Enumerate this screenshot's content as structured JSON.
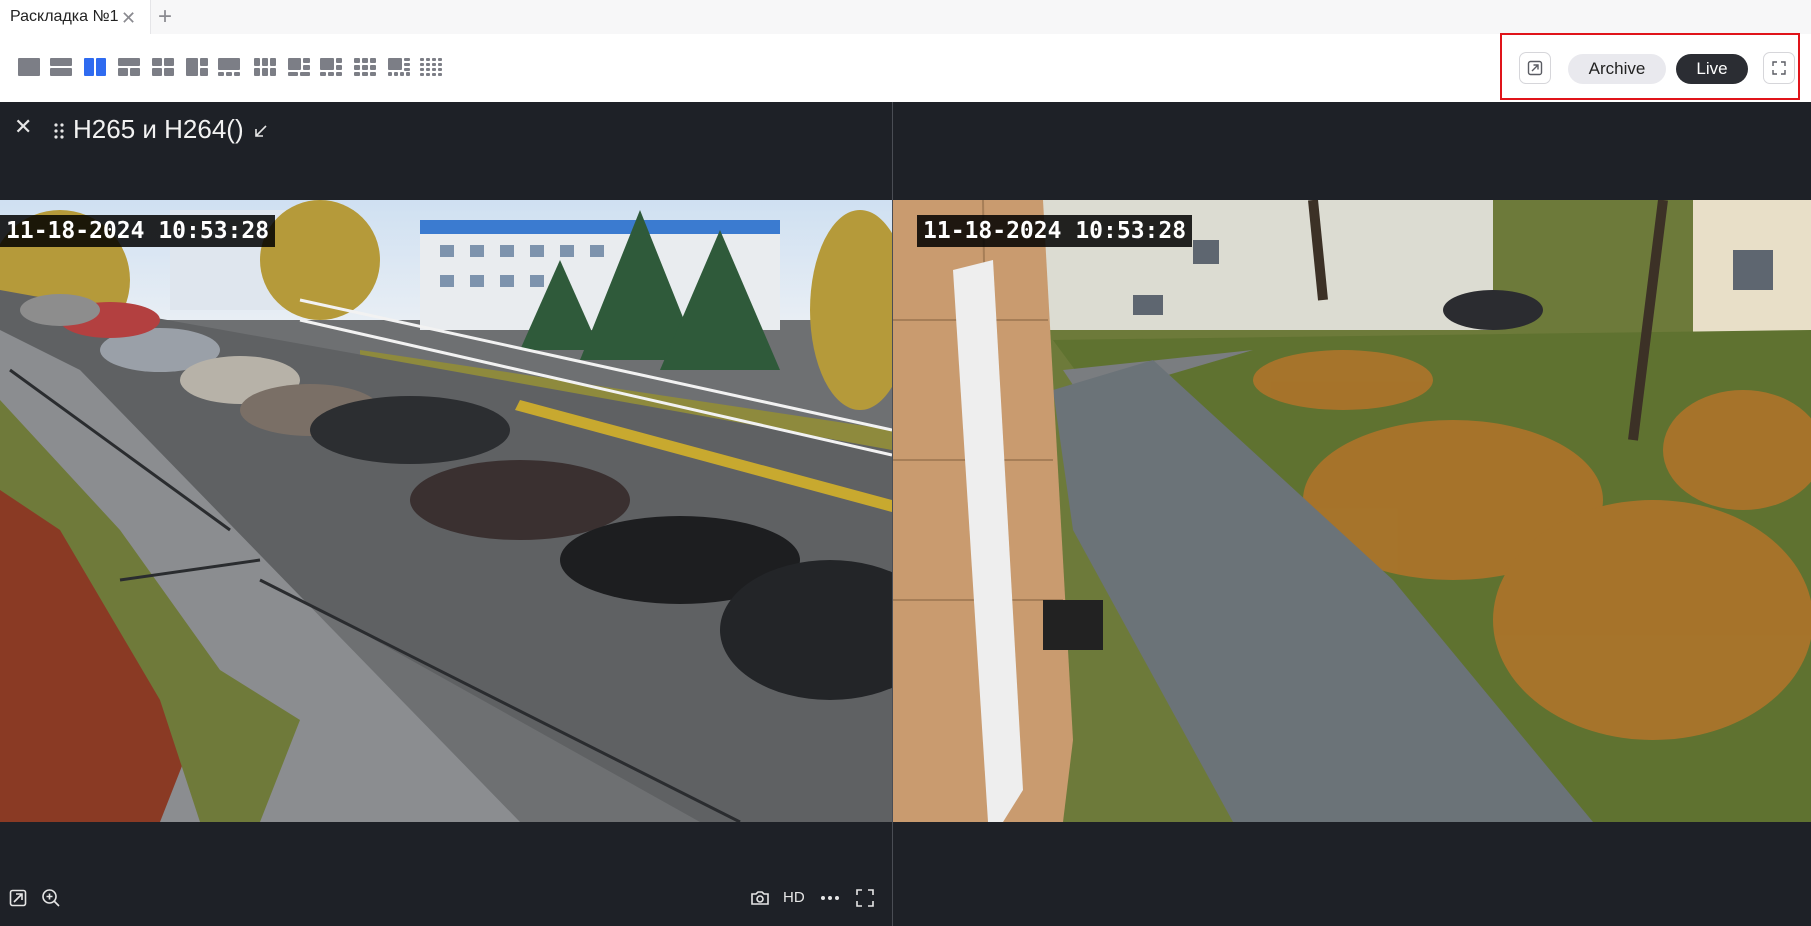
{
  "tabs": [
    {
      "label": "Раскладка №1",
      "close_icon": "close-icon",
      "active": true
    }
  ],
  "add_tab_icon": "plus-icon",
  "layout_buttons": [
    {
      "name": "layout-1x1",
      "active": false
    },
    {
      "name": "layout-2-rows",
      "active": false
    },
    {
      "name": "layout-2-columns",
      "active": true
    },
    {
      "name": "layout-1-top-2-bottom",
      "active": false
    },
    {
      "name": "layout-2x2",
      "active": false
    },
    {
      "name": "layout-1-big-2-side",
      "active": false
    },
    {
      "name": "layout-1-big-3-bottom",
      "active": false
    },
    {
      "name": "layout-3x2",
      "active": false
    },
    {
      "name": "layout-1-big-4",
      "active": false
    },
    {
      "name": "layout-1-big-5",
      "active": false
    },
    {
      "name": "layout-3x3",
      "active": false
    },
    {
      "name": "layout-1-big-7",
      "active": false
    },
    {
      "name": "layout-4x4",
      "active": false
    }
  ],
  "controls": {
    "exit_icon": "open-in-new-window-icon",
    "archive_label": "Archive",
    "live_label": "Live",
    "live_active": true,
    "fullscreen_icon": "fullscreen-icon"
  },
  "pane_header": {
    "close_icon": "close-icon",
    "drag_icon": "drag-handle-icon",
    "title": "H265 и H264()",
    "collapse_icon": "arrow-down-left-icon"
  },
  "cameras": [
    {
      "timestamp": "11-18-2024 10:53:28",
      "scene": "parking lot with cars"
    },
    {
      "timestamp": "11-18-2024 10:53:28",
      "scene": "sidewalk near building"
    }
  ],
  "bottom_controls": {
    "left": [
      "open-in-new-window-icon",
      "zoom-in-icon"
    ],
    "right": [
      "camera-snapshot-icon",
      "more-icon",
      "fullscreen-icon"
    ],
    "quality_label": "HD"
  },
  "colors": {
    "accent": "#2f6bf0",
    "grid_bg": "#1e2127",
    "live_bg": "#2b2d33",
    "highlight_frame": "#e0141a"
  }
}
